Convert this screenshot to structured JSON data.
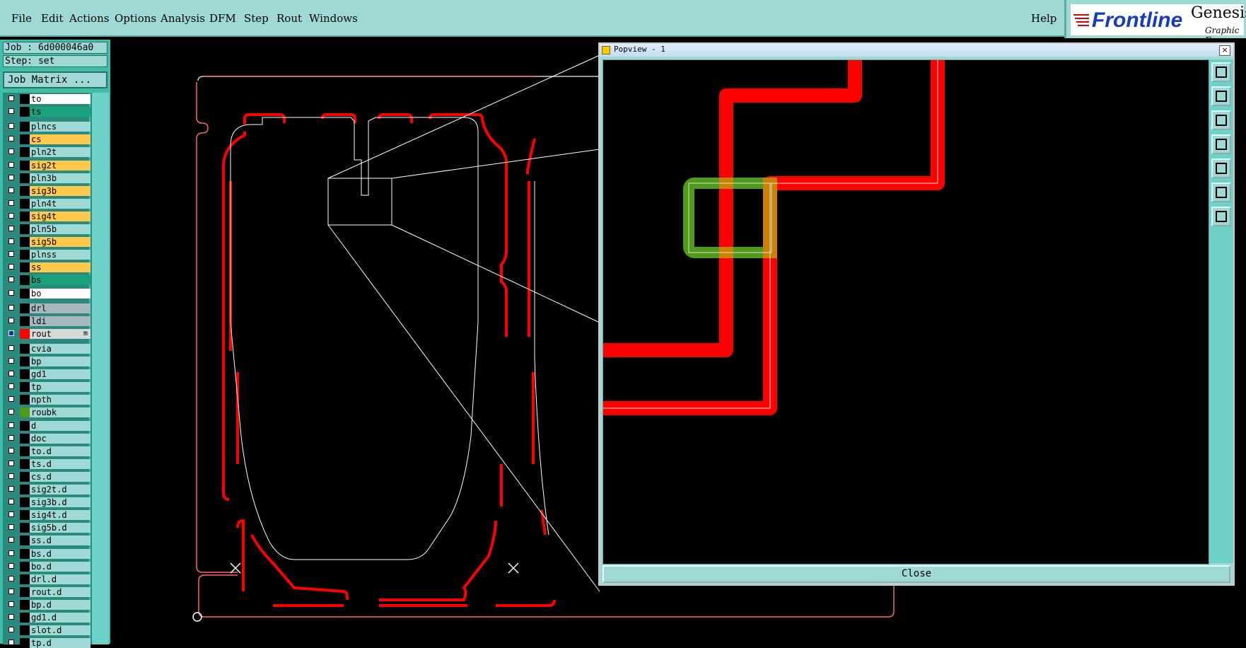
{
  "menu": {
    "file": "File",
    "edit": "Edit",
    "actions": "Actions",
    "options": "Options",
    "analysis": "Analysis",
    "dfm": "DFM",
    "step": "Step",
    "rout": "Rout",
    "windows": "Windows",
    "help": "Help"
  },
  "logo": {
    "brand": "Frontline",
    "product": "Genesis",
    "subtitle": "Graphic E"
  },
  "job": {
    "job_label": "Job : 6d000046a0",
    "step_label": "Step: set",
    "matrix_button": "Job Matrix ..."
  },
  "layers": [
    {
      "name": "to",
      "color": "#ffffff",
      "swatch": "#000000"
    },
    {
      "name": "ts",
      "color": "#1aa27c",
      "swatch": "#000000"
    },
    {
      "name": "plncs",
      "color": "#9fd9d6",
      "swatch": "#000000"
    },
    {
      "name": "cs",
      "color": "#ffc94d",
      "swatch": "#000000"
    },
    {
      "name": "pln2t",
      "color": "#9fd9d6",
      "swatch": "#000000"
    },
    {
      "name": "sig2t",
      "color": "#ffc94d",
      "swatch": "#000000"
    },
    {
      "name": "pln3b",
      "color": "#9fd9d6",
      "swatch": "#000000"
    },
    {
      "name": "sig3b",
      "color": "#ffc94d",
      "swatch": "#000000"
    },
    {
      "name": "pln4t",
      "color": "#9fd9d6",
      "swatch": "#000000"
    },
    {
      "name": "sig4t",
      "color": "#ffc94d",
      "swatch": "#000000"
    },
    {
      "name": "pln5b",
      "color": "#9fd9d6",
      "swatch": "#000000"
    },
    {
      "name": "sig5b",
      "color": "#ffc94d",
      "swatch": "#000000"
    },
    {
      "name": "plnss",
      "color": "#9fd9d6",
      "swatch": "#000000"
    },
    {
      "name": "ss",
      "color": "#ffc94d",
      "swatch": "#000000"
    },
    {
      "name": "bs",
      "color": "#1aa27c",
      "swatch": "#000000"
    },
    {
      "name": "bo",
      "color": "#ffffff",
      "swatch": "#000000"
    },
    {
      "name": "drl",
      "color": "#a9b8c0",
      "swatch": "#000000"
    },
    {
      "name": "ldi",
      "color": "#a9b8c0",
      "swatch": "#000000"
    },
    {
      "name": "rout",
      "color": "#d9d9d9",
      "swatch": "#ff0000",
      "selected": true,
      "flag": "m"
    },
    {
      "name": "cvia",
      "color": "#9fd9d6",
      "swatch": "#000000"
    },
    {
      "name": "bp",
      "color": "#9fd9d6",
      "swatch": "#000000"
    },
    {
      "name": "gd1",
      "color": "#9fd9d6",
      "swatch": "#000000"
    },
    {
      "name": "tp",
      "color": "#9fd9d6",
      "swatch": "#000000"
    },
    {
      "name": "npth",
      "color": "#9fd9d6",
      "swatch": "#000000"
    },
    {
      "name": "roubk",
      "color": "#9fd9d6",
      "swatch": "#4f9a1a"
    },
    {
      "name": "d",
      "color": "#9fd9d6",
      "swatch": "#000000"
    },
    {
      "name": "doc",
      "color": "#9fd9d6",
      "swatch": "#000000"
    },
    {
      "name": "to.d",
      "color": "#9fd9d6",
      "swatch": "#000000"
    },
    {
      "name": "ts.d",
      "color": "#9fd9d6",
      "swatch": "#000000"
    },
    {
      "name": "cs.d",
      "color": "#9fd9d6",
      "swatch": "#000000"
    },
    {
      "name": "sig2t.d",
      "color": "#9fd9d6",
      "swatch": "#000000"
    },
    {
      "name": "sig3b.d",
      "color": "#9fd9d6",
      "swatch": "#000000"
    },
    {
      "name": "sig4t.d",
      "color": "#9fd9d6",
      "swatch": "#000000"
    },
    {
      "name": "sig5b.d",
      "color": "#9fd9d6",
      "swatch": "#000000"
    },
    {
      "name": "ss.d",
      "color": "#9fd9d6",
      "swatch": "#000000"
    },
    {
      "name": "bs.d",
      "color": "#9fd9d6",
      "swatch": "#000000"
    },
    {
      "name": "bo.d",
      "color": "#9fd9d6",
      "swatch": "#000000"
    },
    {
      "name": "drl.d",
      "color": "#9fd9d6",
      "swatch": "#000000"
    },
    {
      "name": "rout.d",
      "color": "#9fd9d6",
      "swatch": "#000000"
    },
    {
      "name": "bp.d",
      "color": "#9fd9d6",
      "swatch": "#000000"
    },
    {
      "name": "gd1.d",
      "color": "#9fd9d6",
      "swatch": "#000000"
    },
    {
      "name": "slot.d",
      "color": "#9fd9d6",
      "swatch": "#000000"
    },
    {
      "name": "tp.d",
      "color": "#9fd9d6",
      "swatch": "#000000"
    }
  ],
  "popview": {
    "title": "Popview - 1",
    "close_button": "Close",
    "close_x": "×",
    "tools": [
      "zoom-fit-icon",
      "pan-up-icon",
      "pan-down-icon",
      "pan-left-icon",
      "pan-right-icon",
      "zoom-in-icon",
      "zoom-out-icon"
    ]
  },
  "colors": {
    "panel": "#9fd9d6",
    "rout": "#ff0000",
    "profile": "#ffffff",
    "roubk": "#4f9a1a",
    "overlap": "#c09a00"
  }
}
